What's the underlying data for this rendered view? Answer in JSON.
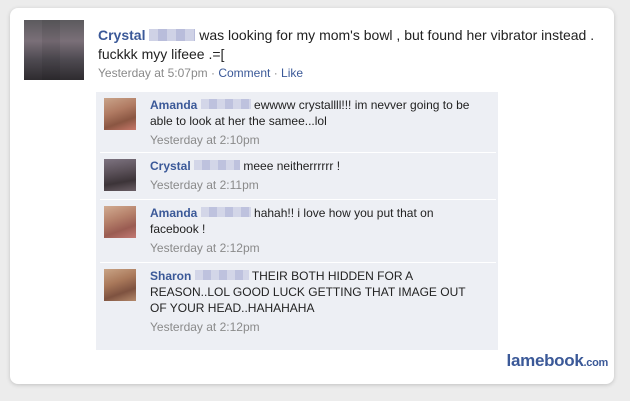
{
  "post": {
    "author": "Crystal",
    "text": "was looking for my mom's bowl , but found her vibrator instead . fuckkk myy lifeee .=[",
    "timestamp": "Yesterday at 5:07pm",
    "separator": "·",
    "comment_link": "Comment",
    "like_link": "Like"
  },
  "comments": [
    {
      "author": "Amanda",
      "text": "ewwww crystallll!!! im nevver going to be able to look at her the samee...lol",
      "timestamp": "Yesterday at 2:10pm"
    },
    {
      "author": "Crystal",
      "text": "meee neitherrrrrr !",
      "timestamp": "Yesterday at 2:11pm"
    },
    {
      "author": "Amanda",
      "text": "hahah!! i love how you put that on facebook !",
      "timestamp": "Yesterday at 2:12pm"
    },
    {
      "author": "Sharon",
      "text": "THEIR BOTH HIDDEN FOR A REASON..LOL GOOD LUCK GETTING THAT IMAGE OUT OF YOUR HEAD..HAHAHAHA",
      "timestamp": "Yesterday at 2:12pm"
    }
  ],
  "watermark": {
    "brand": "lamebook",
    "tld": ".com"
  },
  "colors": {
    "link_blue": "#3b5998",
    "comment_bg": "#edeff4",
    "meta_gray": "#8a8a8a"
  },
  "icons": {
    "avatar": "pixelated-avatar",
    "redaction": "pixelated-redaction"
  }
}
